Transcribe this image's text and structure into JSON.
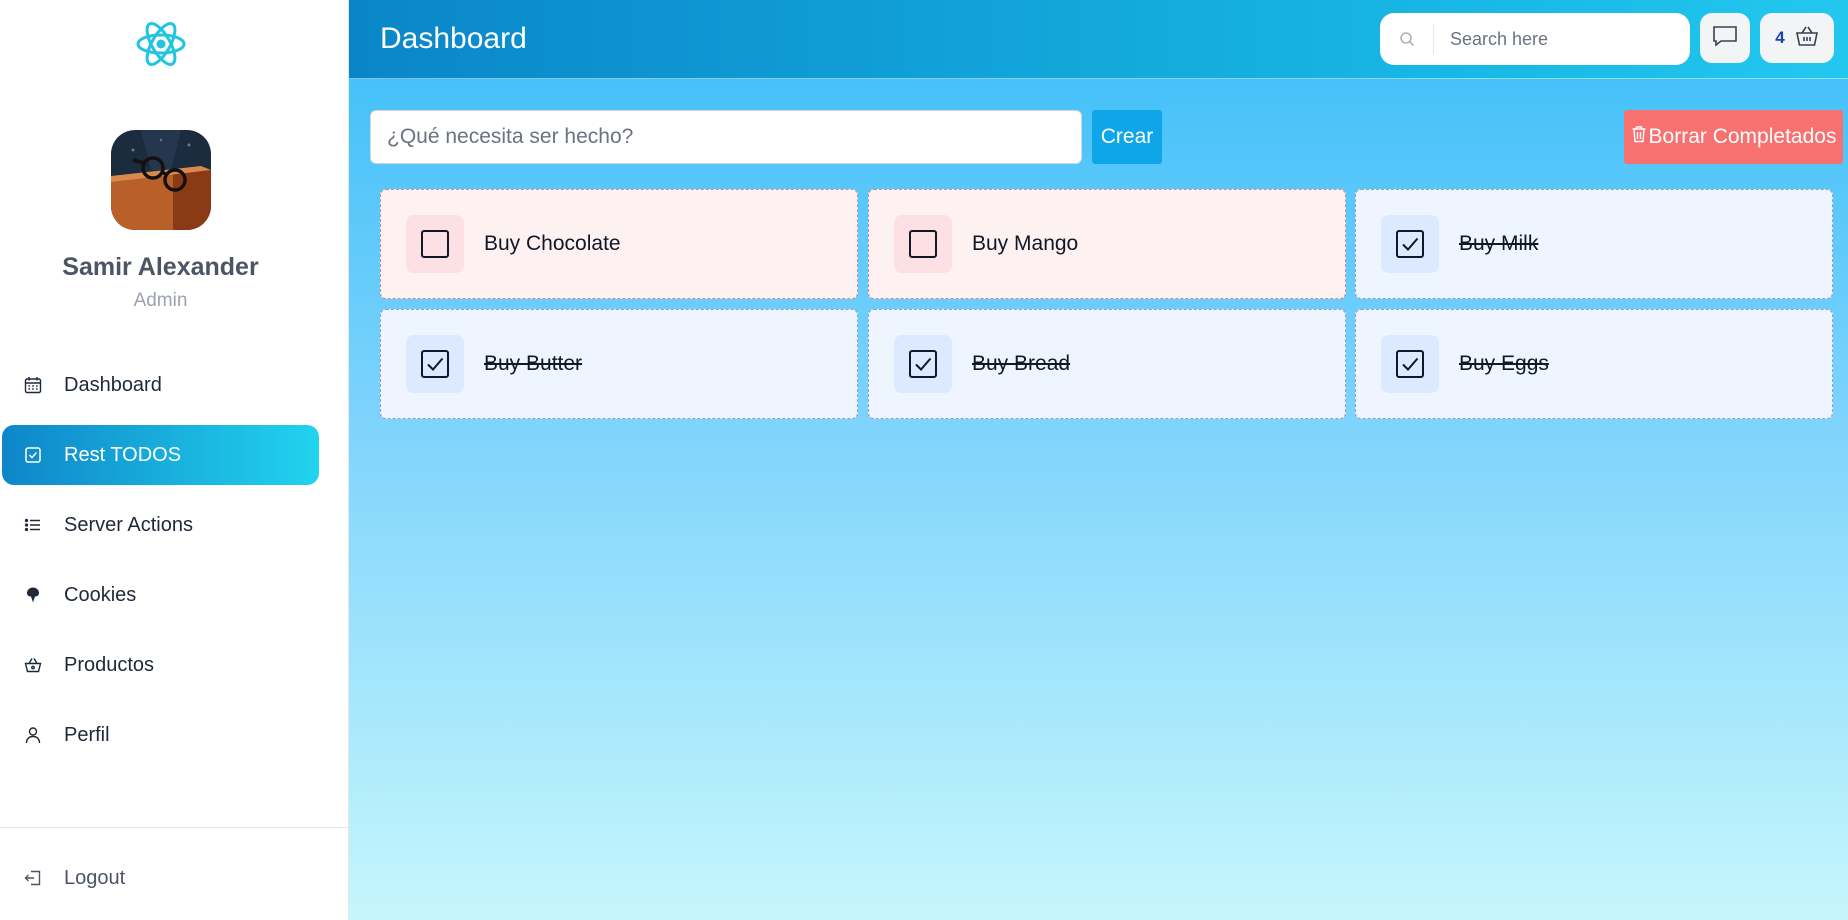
{
  "sidebar": {
    "logo_icon": "react-atom-icon",
    "user": {
      "name": "Samir Alexander",
      "role": "Admin"
    },
    "items": [
      {
        "label": "Dashboard",
        "icon": "calendar-icon",
        "active": false
      },
      {
        "label": "Rest TODOS",
        "icon": "checkbox-icon",
        "active": true
      },
      {
        "label": "Server Actions",
        "icon": "list-icon",
        "active": false
      },
      {
        "label": "Cookies",
        "icon": "cookie-icon",
        "active": false
      },
      {
        "label": "Productos",
        "icon": "basket-icon",
        "active": false
      },
      {
        "label": "Perfil",
        "icon": "user-icon",
        "active": false
      }
    ],
    "logout_label": "Logout"
  },
  "header": {
    "title": "Dashboard",
    "search_placeholder": "Search here",
    "cart_count": "4"
  },
  "todos_form": {
    "input_placeholder": "¿Qué necesita ser hecho?",
    "create_label": "Crear",
    "clear_label": "Borrar Completados"
  },
  "todos": [
    {
      "text": "Buy Chocolate",
      "complete": false
    },
    {
      "text": "Buy Mango",
      "complete": false
    },
    {
      "text": "Buy Milk",
      "complete": true
    },
    {
      "text": "Buy Butter",
      "complete": true
    },
    {
      "text": "Buy Bread",
      "complete": true
    },
    {
      "text": "Buy Eggs",
      "complete": true
    }
  ],
  "colors": {
    "accent": "#0ea5e9",
    "danger": "#f87171",
    "active_nav_start": "#0e86c9",
    "active_nav_end": "#22d3ee"
  }
}
